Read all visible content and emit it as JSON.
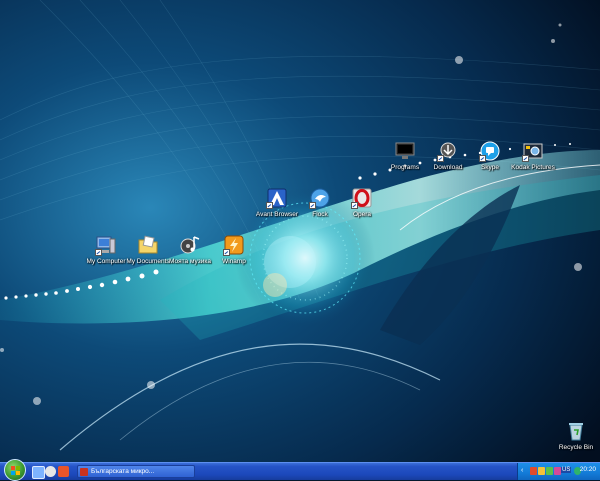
{
  "desktop": {
    "icons": [
      {
        "label": "My Computer",
        "icon": "computer-icon",
        "shortcut": true
      },
      {
        "label": "My Documents",
        "icon": "documents-folder-icon",
        "shortcut": false
      },
      {
        "label": "Моята музика",
        "icon": "music-folder-icon",
        "shortcut": false
      },
      {
        "label": "Winamp",
        "icon": "winamp-icon",
        "shortcut": true
      },
      {
        "label": "Avant Browser",
        "icon": "avant-browser-icon",
        "shortcut": true
      },
      {
        "label": "Flock",
        "icon": "flock-icon",
        "shortcut": true
      },
      {
        "label": "Opera",
        "icon": "opera-icon",
        "shortcut": true
      },
      {
        "label": "Programs",
        "icon": "programs-monitor-icon",
        "shortcut": false
      },
      {
        "label": "Download",
        "icon": "download-icon",
        "shortcut": true
      },
      {
        "label": "Skype",
        "icon": "skype-icon",
        "shortcut": true
      },
      {
        "label": "Kodak Pictures",
        "icon": "kodak-pictures-icon",
        "shortcut": true
      },
      {
        "label": "Recycle Bin",
        "icon": "recycle-bin-icon",
        "shortcut": false
      }
    ]
  },
  "taskbar": {
    "start_icon": "windows-start-orb-icon",
    "quick_launch": [
      "show-desktop-icon",
      "media-player-icon",
      "browser-icon"
    ],
    "active_window": "Българската микро...",
    "tray": {
      "language": "US",
      "clock": "20:20"
    }
  },
  "colors": {
    "wallpaper_dark": "#03142a",
    "wallpaper_cyan": "#3fd8d0",
    "taskbar_blue": "#2554c7",
    "tray_blue": "#137bd7"
  }
}
